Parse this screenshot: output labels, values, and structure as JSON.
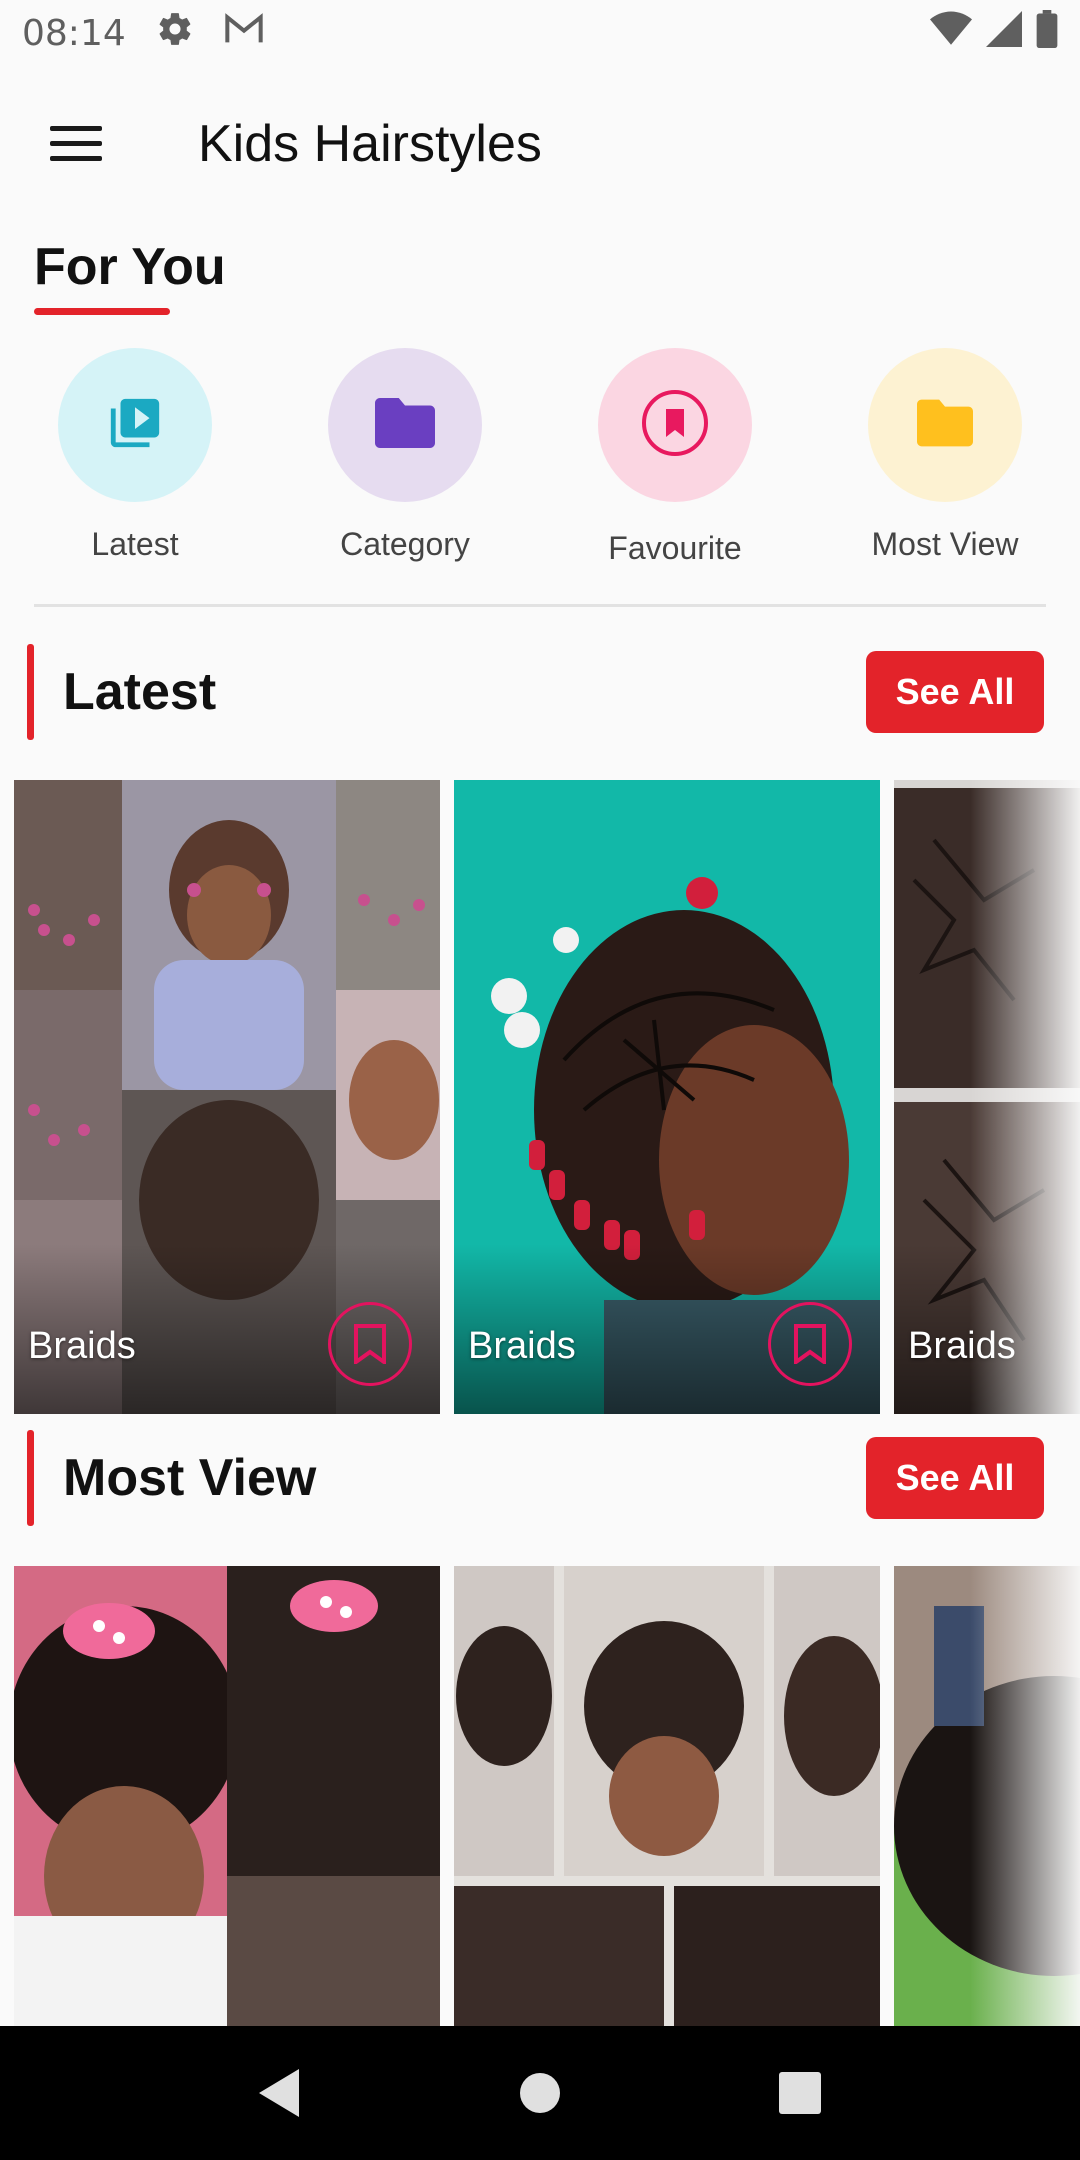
{
  "status_bar": {
    "time": "08:14",
    "icons": [
      "settings-icon",
      "gmail-icon",
      "wifi-icon",
      "signal-icon",
      "battery-icon"
    ]
  },
  "app_bar": {
    "title": "Kids Hairstyles",
    "menu_icon": "hamburger-menu-icon"
  },
  "for_you": {
    "title": "For You",
    "accent": "#e3232a"
  },
  "shortcuts": [
    {
      "label": "Latest",
      "icon": "play-library-icon",
      "icon_color": "#1ba9c2",
      "bg": "#d5f3f7"
    },
    {
      "label": "Category",
      "icon": "folder-icon",
      "icon_color": "#6a3fc1",
      "bg": "#e6dcf0"
    },
    {
      "label": "Favourite",
      "icon": "bookmark-circle-icon",
      "icon_color": "#e8195f",
      "bg": "#fbd6e2"
    },
    {
      "label": "Most View",
      "icon": "folder-icon",
      "icon_color": "#ffc01e",
      "bg": "#fdf2d2"
    }
  ],
  "sections": {
    "latest": {
      "title": "Latest",
      "see_all": "See All",
      "cards": [
        {
          "label": "Braids",
          "bookmark": true
        },
        {
          "label": "Braids",
          "bookmark": true
        },
        {
          "label": "Braids",
          "bookmark": false
        }
      ]
    },
    "most_view": {
      "title": "Most View",
      "see_all": "See All",
      "cards": [
        {
          "label": "",
          "bookmark": false
        },
        {
          "label": "",
          "bookmark": false
        },
        {
          "label": "",
          "bookmark": false
        }
      ]
    }
  },
  "nav_bar": {
    "buttons": [
      "back-icon",
      "home-icon",
      "recents-icon"
    ]
  },
  "colors": {
    "accent": "#e3232a",
    "bookmark": "#e3135f",
    "background": "#fafafa"
  }
}
